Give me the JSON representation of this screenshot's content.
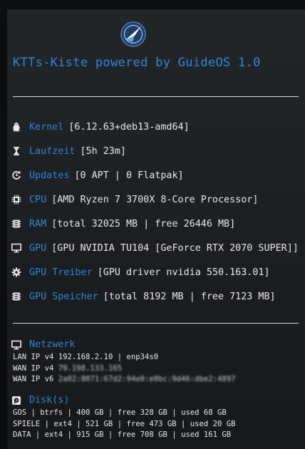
{
  "title": "KTTs-Kiste powered by GuideOS 1.0",
  "accent_color": "#2f86d4",
  "logo_icon": "guideos-compass-logo",
  "system": [
    {
      "icon": "linux-penguin-icon",
      "label": "Kernel",
      "value": "[6.12.63+deb13-amd64]"
    },
    {
      "icon": "hourglass-icon",
      "label": "Laufzeit",
      "value": "[5h 23m]"
    },
    {
      "icon": "refresh-icon",
      "label": "Updates",
      "value": "[0 APT | 0 Flatpak]"
    },
    {
      "icon": "cpu-icon",
      "label": "CPU",
      "value": "[AMD Ryzen 7 3700X 8-Core Processor]"
    },
    {
      "icon": "memory-icon",
      "label": "RAM",
      "value": "[total 32025 MB | free 26446 MB]"
    },
    {
      "icon": "monitor-icon",
      "label": "GPU",
      "value": "[GPU NVIDIA TU104 [GeForce RTX 2070 SUPER]]"
    },
    {
      "icon": "gear-icon",
      "label": "GPU Treiber",
      "value": "[GPU driver nvidia 550.163.01]"
    },
    {
      "icon": "memory-icon",
      "label": "GPU Speicher",
      "value": "[total 8192 MB | free 7123 MB]"
    }
  ],
  "network": {
    "icon": "monitor-icon",
    "label": "Netzwerk",
    "lines": [
      {
        "prefix": "LAN IP v4 ",
        "value": "192.168.2.10 | enp34s0"
      },
      {
        "prefix": "WAN IP v4 ",
        "value": "79.198.133.165"
      },
      {
        "prefix": "WAN IP v6 ",
        "value": "2a02:8071:67d2:94e0:e0bc:9d46:dbe2:4897"
      }
    ]
  },
  "disks": {
    "icon": "disk-icon",
    "label": "Disk(s)",
    "lines": [
      "GOS | btrfs | 400 GB | free 328 GB | used 68 GB",
      "SPIELE | ext4 | 521 GB | free 473 GB | used 20 GB",
      "DATA | ext4 | 915 GB | free 708 GB | used 161 GB"
    ]
  }
}
